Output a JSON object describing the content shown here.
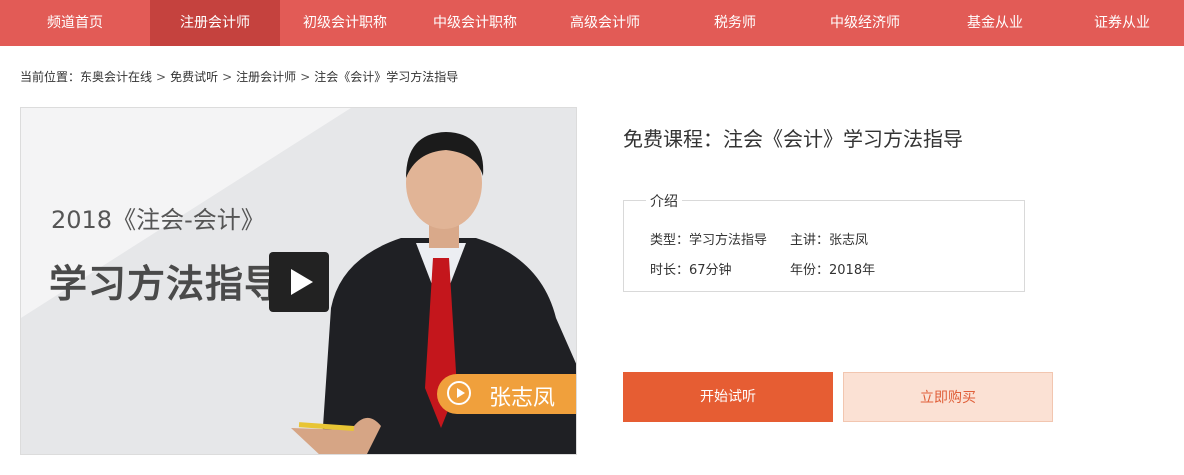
{
  "nav": {
    "items": [
      {
        "label": "频道首页",
        "active": false
      },
      {
        "label": "注册会计师",
        "active": true
      },
      {
        "label": "初级会计职称",
        "active": false
      },
      {
        "label": "中级会计职称",
        "active": false
      },
      {
        "label": "高级会计师",
        "active": false
      },
      {
        "label": "税务师",
        "active": false
      },
      {
        "label": "中级经济师",
        "active": false
      },
      {
        "label": "基金从业",
        "active": false
      },
      {
        "label": "证券从业",
        "active": false
      }
    ]
  },
  "breadcrumb": {
    "prefix": "当前位置：",
    "items": [
      "东奥会计在线",
      "免费试听",
      "注册会计师",
      "注会《会计》学习方法指导"
    ],
    "separator": ">"
  },
  "poster": {
    "year_line": "2018《注会-会计》",
    "title_line": "学习方法指导",
    "teacher": "张志凤"
  },
  "course": {
    "title": "免费课程：注会《会计》学习方法指导",
    "intro_label": "介绍",
    "type": "类型：学习方法指导",
    "lecturer": "主讲：张志凤",
    "duration": "时长：67分钟",
    "year": "年份：2018年"
  },
  "actions": {
    "start_label": "开始试听",
    "buy_label": "立即购买"
  },
  "colors": {
    "nav_bg": "#e25b56",
    "nav_active": "#c5423e",
    "start_btn": "#e65d33",
    "buy_btn_bg": "#fbe1d4",
    "name_tag": "#f0a03c"
  }
}
